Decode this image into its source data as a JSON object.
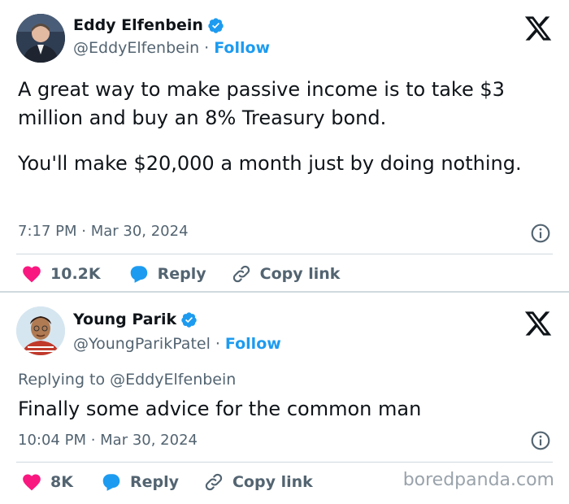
{
  "tweets": [
    {
      "author_name": "Eddy Elfenbein",
      "handle": "@EddyElfenbein",
      "separator": "·",
      "follow_label": "Follow",
      "text_p1": "A great way to make passive income is to take $3 million and buy an 8% Treasury bond.",
      "text_p2": "You'll make $20,000 a month just by doing nothing.",
      "timestamp": "7:17 PM · Mar 30, 2024",
      "likes": "10.2K",
      "reply_label": "Reply",
      "copy_label": "Copy link"
    },
    {
      "author_name": "Young Parik",
      "handle": "@YoungParikPatel",
      "separator": "·",
      "follow_label": "Follow",
      "replying_to": "Replying to @EddyElfenbein",
      "text": "Finally some advice for the common man",
      "timestamp": "10:04 PM · Mar 30, 2024",
      "likes": "8K",
      "reply_label": "Reply",
      "copy_label": "Copy link"
    }
  ],
  "watermark": "boredpanda.com",
  "icons": [
    "verified-badge-icon",
    "x-logo-icon",
    "info-icon",
    "heart-icon",
    "reply-bubble-icon",
    "link-icon"
  ],
  "colors": {
    "accent": "#1d9bf0",
    "heart": "#f91880",
    "muted": "#536471",
    "text": "#0f1419"
  }
}
